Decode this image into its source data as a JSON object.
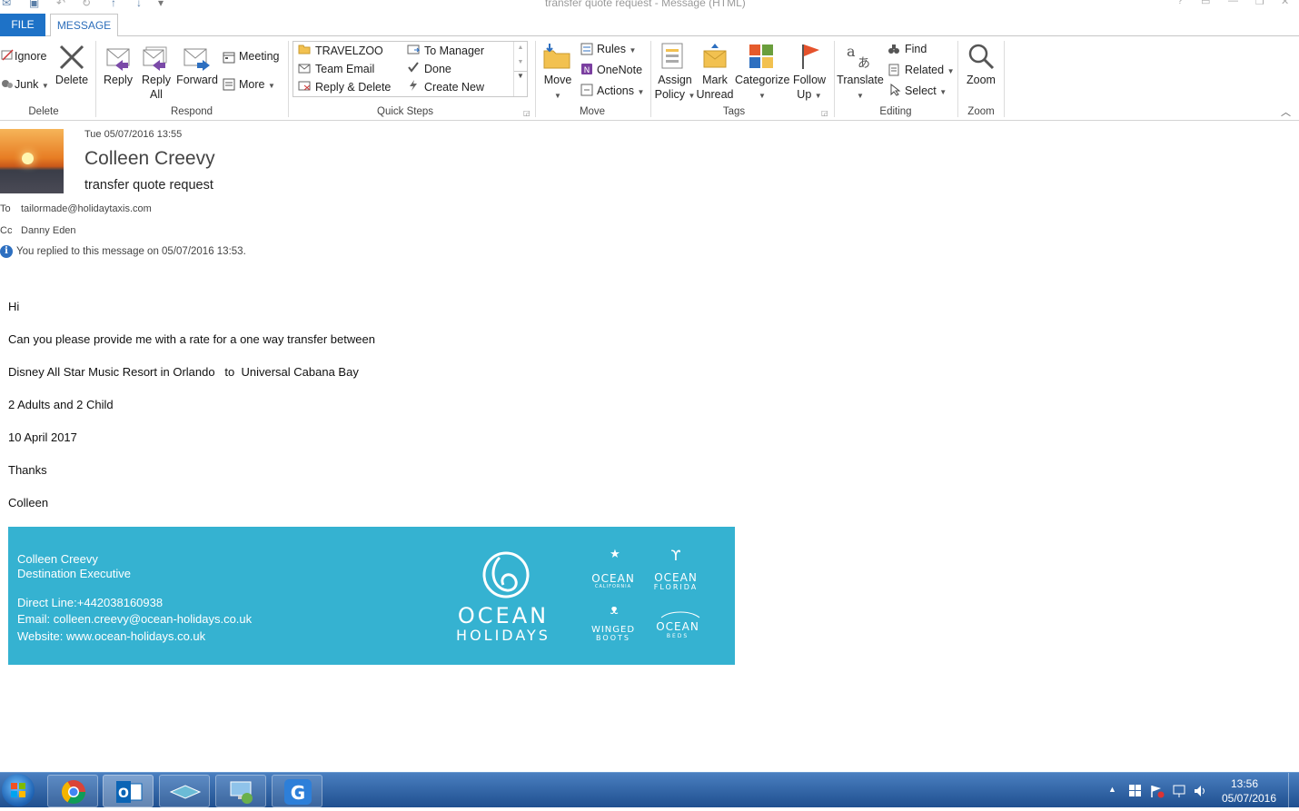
{
  "window": {
    "title": "transfer quote request - Message (HTML)",
    "tabs": [
      "FILE",
      "MESSAGE"
    ]
  },
  "ribbon": {
    "delete_group": {
      "label": "Delete",
      "ignore": "Ignore",
      "junk": "Junk",
      "delete": "Delete"
    },
    "respond_group": {
      "label": "Respond",
      "reply": "Reply",
      "reply_all_1": "Reply",
      "reply_all_2": "All",
      "forward": "Forward",
      "meeting": "Meeting",
      "more": "More"
    },
    "quick_steps": {
      "label": "Quick Steps",
      "items": [
        "TRAVELZOO",
        "Team Email",
        "Reply & Delete",
        "To Manager",
        "Done",
        "Create New"
      ]
    },
    "move_group": {
      "label": "Move",
      "move": "Move",
      "rules": "Rules",
      "onenote": "OneNote",
      "actions": "Actions"
    },
    "tags_group": {
      "label": "Tags",
      "assign_1": "Assign",
      "assign_2": "Policy",
      "mark_1": "Mark",
      "mark_2": "Unread",
      "categorize": "Categorize",
      "follow_1": "Follow",
      "follow_2": "Up"
    },
    "editing_group": {
      "label": "Editing",
      "translate": "Translate",
      "find": "Find",
      "related": "Related",
      "select": "Select"
    },
    "zoom_group": {
      "label": "Zoom",
      "zoom": "Zoom"
    }
  },
  "header": {
    "date": "Tue 05/07/2016 13:55",
    "sender": "Colleen Creevy",
    "subject": "transfer quote request",
    "to_label": "To",
    "to_value": "tailormade@holidaytaxis.com",
    "cc_label": "Cc",
    "cc_value": "Danny Eden",
    "info": "You replied to this message on 05/07/2016 13:53."
  },
  "body": {
    "lines": [
      "Hi",
      "Can you please provide me with a rate for a one way transfer between",
      "Disney All Star Music Resort in Orlando   to  Universal Cabana Bay",
      "2 Adults and 2 Child",
      "10 April 2017",
      "Thanks",
      "Colleen"
    ]
  },
  "signature": {
    "name": "Colleen Creevy",
    "title": "Destination Executive",
    "direct": "Direct Line:+442038160938",
    "email": "Email: colleen.creevy@ocean-holidays.co.uk",
    "website": "Website: www.ocean-holidays.co.uk",
    "logo_main_1": "OCEAN",
    "logo_main_2": "HOLIDAYS",
    "sub_logos": [
      {
        "l1": "OCEAN",
        "l2": "CALIFORNIA"
      },
      {
        "l1": "OCEAN",
        "l2": "FLORIDA"
      },
      {
        "l1": "WINGED",
        "l2": "BOOTS"
      },
      {
        "l1": "OCEAN",
        "l2": "BEDS"
      }
    ],
    "color": "#35b2d1"
  },
  "taskbar": {
    "time": "13:56",
    "date": "05/07/2016",
    "apps": [
      "chrome-icon",
      "outlook-icon",
      "app-icon",
      "remote-desktop-icon",
      "g-app-icon"
    ]
  }
}
